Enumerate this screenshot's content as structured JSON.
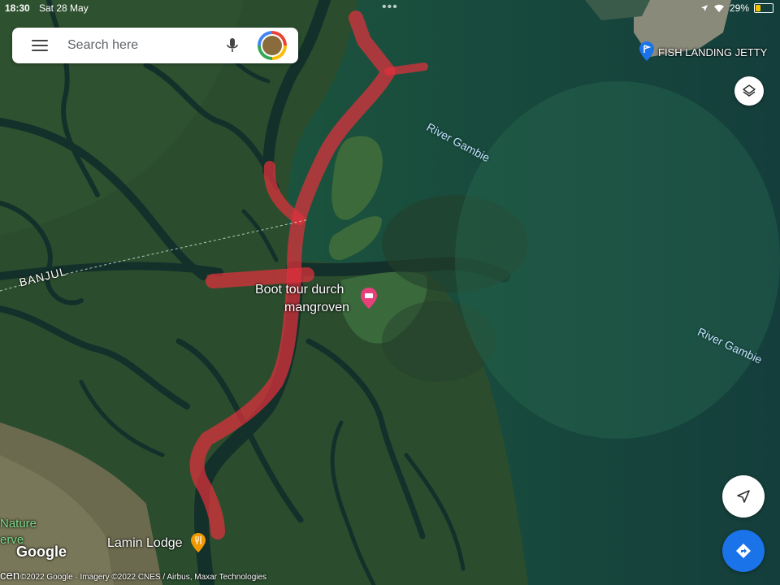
{
  "status_bar": {
    "time": "18:30",
    "date": "Sat 28 May",
    "battery": "29%",
    "battery_level": 0.29
  },
  "search": {
    "placeholder": "Search here"
  },
  "labels": {
    "fish_landing": "FISH LANDING JETTY",
    "river_north": "River Gambie",
    "river_east": "River Gambie",
    "banjul": "BANJUL",
    "boot_tour_line1": "Boot tour durch",
    "boot_tour_line2": "mangroven",
    "lamin_lodge": "Lamin Lodge",
    "nature_line1": "Nature",
    "nature_line2": "erve",
    "bottom_left": "cen"
  },
  "branding": {
    "logo": "Google",
    "attribution": "©2022 Google · Imagery ©2022 CNES / Airbus, Maxar Technologies"
  },
  "icons": [
    "menu-icon",
    "mic-icon",
    "layers-icon",
    "navigate-icon",
    "directions-icon"
  ],
  "colors": {
    "route": "#e0303c",
    "directions_button": "#1a73e8",
    "pin_blue": "#1a73e8",
    "pin_pink": "#e8407a",
    "pin_orange": "#f29900"
  }
}
